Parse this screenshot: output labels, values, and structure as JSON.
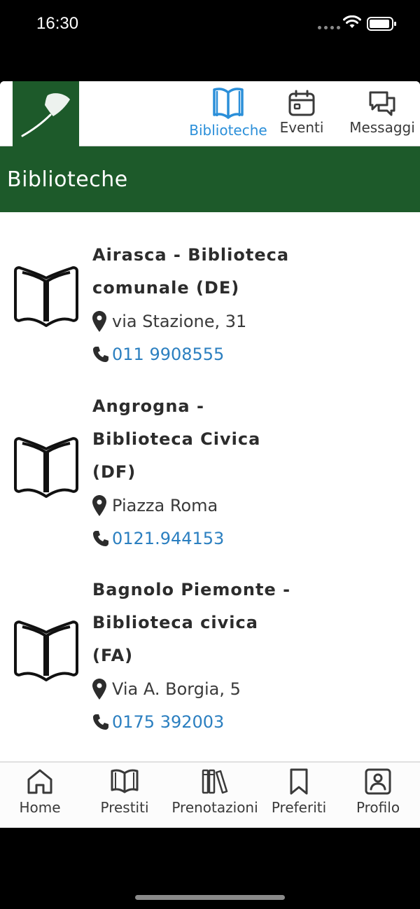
{
  "status_bar": {
    "time": "16:30"
  },
  "top_nav": {
    "items": [
      {
        "label": "Biblioteche",
        "icon": "open-book-icon",
        "active": true
      },
      {
        "label": "Eventi",
        "icon": "calendar-icon",
        "active": false
      },
      {
        "label": "Messaggi",
        "icon": "chat-icon",
        "active": false
      }
    ]
  },
  "header": {
    "title": "Biblioteche"
  },
  "libraries": [
    {
      "name_lines": [
        "Airasca - Biblioteca",
        "comunale (DE)"
      ],
      "address": "via Stazione, 31",
      "phone": "011 9908555"
    },
    {
      "name_lines": [
        "Angrogna -",
        "Biblioteca Civica",
        "(DF)"
      ],
      "address": "Piazza Roma",
      "phone": "0121.944153"
    },
    {
      "name_lines": [
        "Bagnolo Piemonte -",
        "Biblioteca civica",
        "(FA)"
      ],
      "address": "Via A. Borgia, 5",
      "phone": "0175 392003"
    }
  ],
  "tab_bar": {
    "items": [
      {
        "label": "Home",
        "icon": "home-icon"
      },
      {
        "label": "Prestiti",
        "icon": "book-icon"
      },
      {
        "label": "Prenotazioni",
        "icon": "books-shelf-icon"
      },
      {
        "label": "Preferiti",
        "icon": "bookmark-icon"
      },
      {
        "label": "Profilo",
        "icon": "profile-icon"
      }
    ]
  },
  "colors": {
    "brand_green": "#1d5a2a",
    "active_blue": "#2b8fd9",
    "link_blue": "#2b7fc0"
  }
}
